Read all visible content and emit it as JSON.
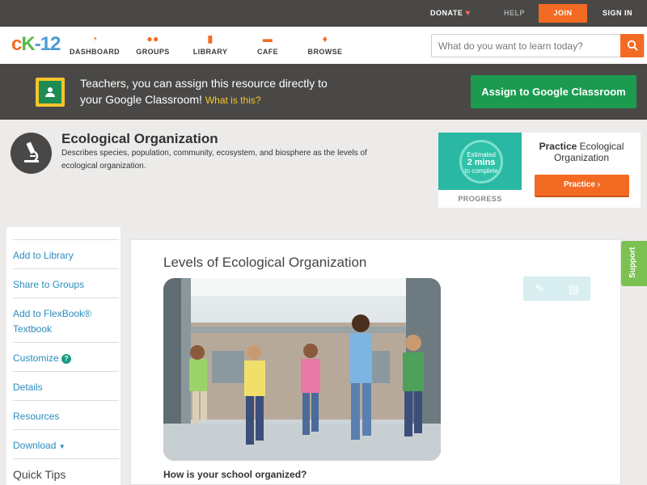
{
  "topbar": {
    "donate": "DONATE",
    "help": "HELP",
    "join": "JOIN",
    "signin": "SIGN IN"
  },
  "nav": {
    "logo": {
      "c": "c",
      "k": "K",
      "n": "-12"
    },
    "items": [
      {
        "label": "DASHBOARD",
        "icon": "dashboard-icon"
      },
      {
        "label": "GROUPS",
        "icon": "groups-icon"
      },
      {
        "label": "LIBRARY",
        "icon": "library-icon"
      },
      {
        "label": "CAFE",
        "icon": "cafe-icon"
      },
      {
        "label": "BROWSE",
        "icon": "browse-icon"
      }
    ],
    "search_placeholder": "What do you want to learn today?"
  },
  "banner": {
    "line1": "Teachers, you can assign this resource directly to",
    "line2": "your Google Classroom!",
    "what": "What is this?",
    "assign": "Assign to Google Classroom"
  },
  "concept": {
    "title": "Ecological Organization",
    "description": "Describes species, population, community, ecosystem, and biosphere as the levels of ecological organization."
  },
  "practice": {
    "estimated": "Estimated",
    "mins": "2 mins",
    "complete": "to complete",
    "progress": "PROGRESS",
    "heading_bold": "Practice",
    "heading_rest": " Ecological Organization",
    "button": "Practice"
  },
  "sidebar": {
    "items": [
      {
        "label": "Add to Library"
      },
      {
        "label": "Share to Groups"
      },
      {
        "label": "Add to FlexBook® Textbook"
      },
      {
        "label": "Customize"
      },
      {
        "label": "Details"
      },
      {
        "label": "Resources"
      },
      {
        "label": "Download"
      },
      {
        "label": "Quick Tips"
      }
    ]
  },
  "article": {
    "title": "Levels of Ecological Organization",
    "question": "How is your school organized?"
  },
  "support": "Support",
  "colors": {
    "accent": "#f36b22",
    "banner": "#4a4846",
    "assign": "#1c9b50",
    "link": "#2a8cbf",
    "support": "#7cc151"
  }
}
